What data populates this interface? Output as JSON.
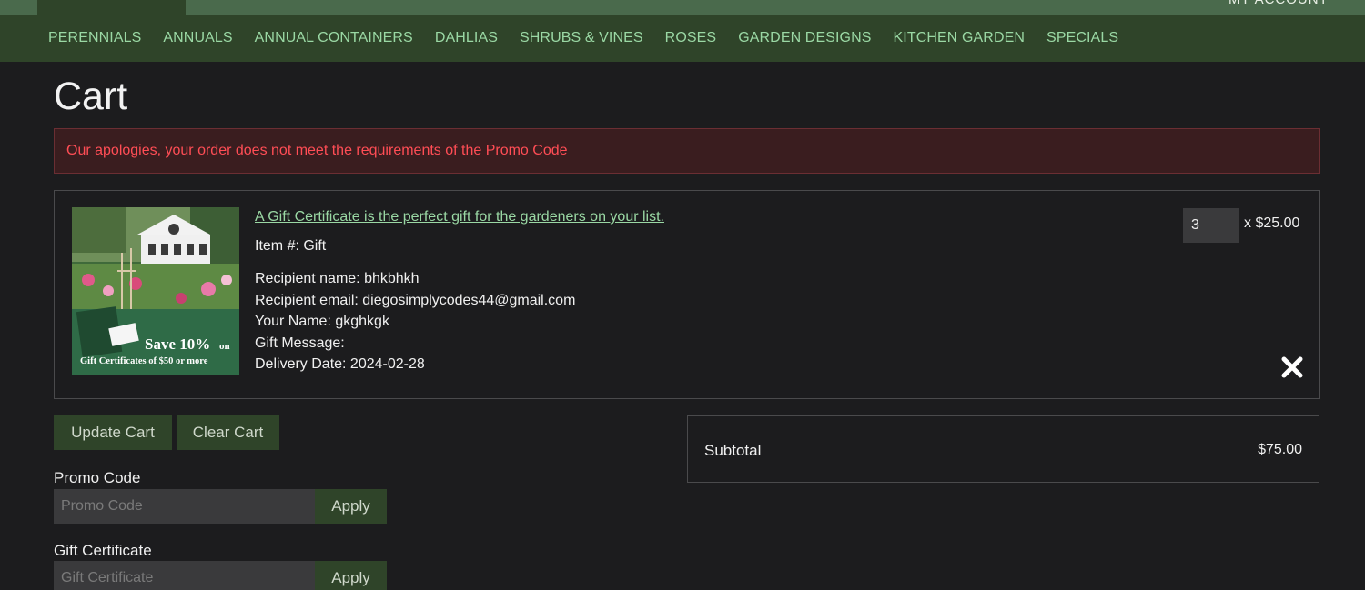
{
  "top_bar": {
    "account_label": "MY ACCOUNT"
  },
  "nav": {
    "items": [
      "PERENNIALS",
      "ANNUALS",
      "ANNUAL CONTAINERS",
      "DAHLIAS",
      "SHRUBS & VINES",
      "ROSES",
      "GARDEN DESIGNS",
      "KITCHEN GARDEN",
      "SPECIALS"
    ]
  },
  "page": {
    "title": "Cart",
    "alert": "Our apologies, your order does not meet the requirements of the Promo Code"
  },
  "cart_item": {
    "link_text": "A Gift Certificate is the perfect gift for the gardeners on your list.",
    "item_number": "Item #: Gift",
    "recipient_name": "Recipient name: bhkbhkh",
    "recipient_email": "Recipient email: diegosimplycodes44@gmail.com",
    "your_name": "Your Name: gkghkgk",
    "gift_message": "Gift Message:",
    "delivery_date": "Delivery Date: 2024-02-28",
    "quantity": "3",
    "unit_price": "x $25.00",
    "image_banner_line1": "Save 10%",
    "image_banner_on": "on",
    "image_banner_line2": "Gift Certificates of $50 or more"
  },
  "actions": {
    "update_cart": "Update Cart",
    "clear_cart": "Clear Cart"
  },
  "promo": {
    "label": "Promo Code",
    "placeholder": "Promo Code",
    "apply": "Apply"
  },
  "gift_certificate": {
    "label": "Gift Certificate",
    "placeholder": "Gift Certificate",
    "apply": "Apply"
  },
  "summary": {
    "subtotal_label": "Subtotal",
    "subtotal_value": "$75.00"
  },
  "colors": {
    "nav_bg": "#2f4429",
    "link_green": "#9ad8a4",
    "alert_red": "#ff4d55",
    "page_bg": "#1c1c1e"
  }
}
